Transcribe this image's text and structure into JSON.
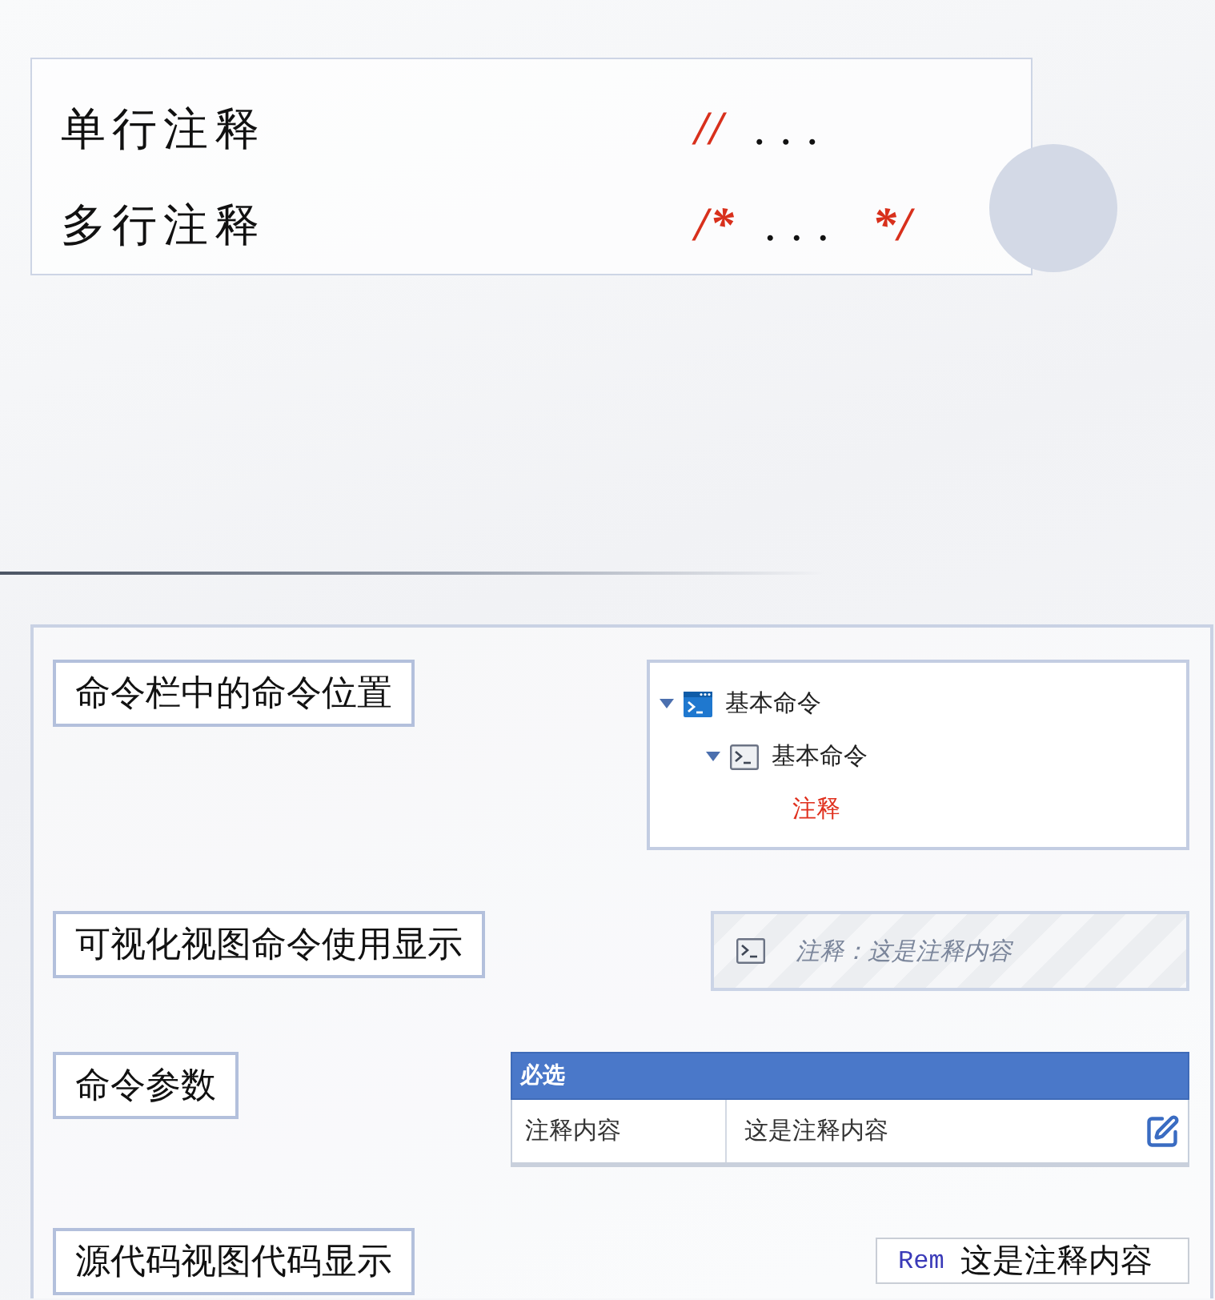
{
  "comment_syntax": {
    "rows": [
      {
        "label": "单行注释",
        "code": [
          {
            "kind": "symbol",
            "text": "//"
          },
          {
            "kind": "body",
            "text": "..."
          }
        ]
      },
      {
        "label": "多行注释",
        "code": [
          {
            "kind": "symbol",
            "text": "/*"
          },
          {
            "kind": "body",
            "text": "..."
          },
          {
            "kind": "symbol",
            "text": "*/"
          }
        ]
      }
    ]
  },
  "sections": [
    {
      "label": "命令栏中的命令位置",
      "kind": "tree",
      "tree": [
        {
          "label": "基本命令",
          "expanded": true,
          "highlighted": false,
          "children": [
            {
              "label": "基本命令",
              "expanded": true,
              "highlighted": false,
              "children": [
                {
                  "label": "注释",
                  "highlighted": true
                }
              ]
            }
          ]
        }
      ]
    },
    {
      "label": "可视化视图命令使用显示",
      "kind": "block",
      "text": "注释：这是注释内容"
    },
    {
      "label": "命令参数",
      "kind": "table",
      "header": "必选",
      "rows": [
        {
          "name": "注释内容",
          "value": "这是注释内容"
        }
      ]
    },
    {
      "label": "源代码视图代码显示",
      "kind": "code",
      "keyword": "Rem",
      "text": "这是注释内容"
    }
  ]
}
